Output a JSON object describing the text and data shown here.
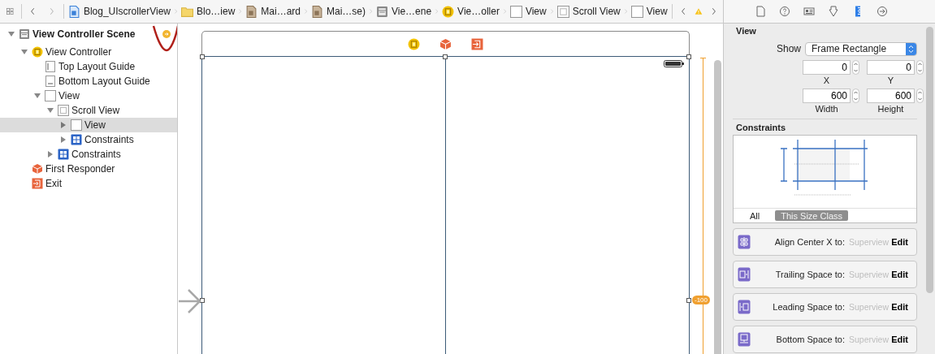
{
  "jump_bar": {
    "crumbs": [
      {
        "kind": "project",
        "label": "Blog_UIscrollerView"
      },
      {
        "kind": "folder",
        "label": "Blo…iew"
      },
      {
        "kind": "storyboard",
        "label": "Mai…ard"
      },
      {
        "kind": "storyboard",
        "label": "Mai…se)"
      },
      {
        "kind": "scene",
        "label": "Vie…ene"
      },
      {
        "kind": "controller",
        "label": "Vie…oller"
      },
      {
        "kind": "view",
        "label": "View"
      },
      {
        "kind": "scrollview",
        "label": "Scroll View"
      },
      {
        "kind": "view",
        "label": "View"
      }
    ]
  },
  "outline": {
    "items": [
      {
        "kind": "scene",
        "label": "View Controller Scene",
        "expanded": true,
        "selected": false,
        "children": [
          {
            "kind": "controller",
            "label": "View Controller",
            "expanded": true,
            "selected": false,
            "children": [
              {
                "kind": "guide-top",
                "label": "Top Layout Guide",
                "selected": false
              },
              {
                "kind": "guide-bottom",
                "label": "Bottom Layout Guide",
                "selected": false
              },
              {
                "kind": "view",
                "label": "View",
                "expanded": true,
                "selected": false,
                "children": [
                  {
                    "kind": "scrollview",
                    "label": "Scroll View",
                    "expanded": true,
                    "selected": false,
                    "children": [
                      {
                        "kind": "view",
                        "label": "View",
                        "expanded": false,
                        "selected": true
                      },
                      {
                        "kind": "constraints",
                        "label": "Constraints",
                        "expanded": false,
                        "selected": false
                      }
                    ]
                  },
                  {
                    "kind": "constraints",
                    "label": "Constraints",
                    "expanded": false,
                    "selected": false
                  }
                ]
              }
            ]
          },
          {
            "kind": "responder",
            "label": "First Responder",
            "selected": false
          },
          {
            "kind": "exit",
            "label": "Exit",
            "selected": false
          }
        ]
      }
    ]
  },
  "canvas": {
    "dock": [
      {
        "kind": "controller"
      },
      {
        "kind": "responder"
      },
      {
        "kind": "exit"
      }
    ],
    "badge": "-100"
  },
  "inspector": {
    "tabs": [
      {
        "kind": "file",
        "selected": false
      },
      {
        "kind": "help",
        "selected": false
      },
      {
        "kind": "identity",
        "selected": false
      },
      {
        "kind": "attributes",
        "selected": false
      },
      {
        "kind": "size",
        "selected": true
      },
      {
        "kind": "connections",
        "selected": false
      }
    ],
    "title": "View",
    "show_label": "Show",
    "show_value": "Frame Rectangle",
    "fields": [
      {
        "label": "X",
        "value": "0"
      },
      {
        "label": "Y",
        "value": "0"
      },
      {
        "label": "Width",
        "value": "600"
      },
      {
        "label": "Height",
        "value": "600"
      }
    ],
    "constraints_title": "Constraints",
    "size_class_tabs": [
      {
        "label": "All",
        "selected": false
      },
      {
        "label": "This Size Class",
        "selected": true
      }
    ],
    "constraints": [
      {
        "kind": "align-center-x",
        "label": "Align Center X to:",
        "target": "Superview",
        "action": "Edit"
      },
      {
        "kind": "trailing",
        "label": "Trailing Space to:",
        "target": "Superview",
        "action": "Edit"
      },
      {
        "kind": "leading",
        "label": "Leading Space to:",
        "target": "Superview",
        "action": "Edit"
      },
      {
        "kind": "bottom",
        "label": "Bottom Space to:",
        "target": "Superview",
        "action": "Edit"
      }
    ]
  }
}
